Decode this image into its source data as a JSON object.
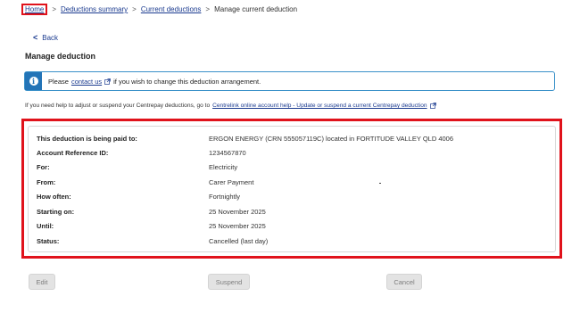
{
  "breadcrumb": {
    "home": "Home",
    "deductions_summary": "Deductions summary",
    "current_deductions": "Current deductions",
    "current_page": "Manage current deduction",
    "separator": ">"
  },
  "back_link": {
    "label": "Back",
    "chevron": "<"
  },
  "page_title": "Manage deduction",
  "info_box": {
    "prefix": "Please",
    "link_text": "contact us",
    "suffix": "if you wish to change this deduction arrangement.",
    "icon": "info-icon"
  },
  "help_text": {
    "prefix": "If you need help to adjust or suspend your Centrepay deductions, go to",
    "link_text": "Centrelink online account help - Update or suspend a current Centrepay deduction"
  },
  "details": [
    {
      "label": "This deduction is being paid to:",
      "value": "ERGON ENERGY (CRN 555057119C) located in FORTITUDE VALLEY QLD 4006"
    },
    {
      "label": "Account Reference ID:",
      "value": "1234567870"
    },
    {
      "label": "For:",
      "value": "Electricity"
    },
    {
      "label": "From:",
      "value": "Carer Payment"
    },
    {
      "label": "How often:",
      "value": "Fortnightly"
    },
    {
      "label": "Starting on:",
      "value": "25 November 2025"
    },
    {
      "label": "Until:",
      "value": "25 November 2025"
    },
    {
      "label": "Status:",
      "value": "Cancelled (last day)"
    }
  ],
  "buttons": {
    "edit": "Edit",
    "suspend": "Suspend",
    "cancel": "Cancel"
  },
  "colors": {
    "link": "#1a3a8f",
    "highlight": "#e0121b",
    "info_accent": "#2374b7",
    "disabled_button": "#e3e3e3"
  }
}
